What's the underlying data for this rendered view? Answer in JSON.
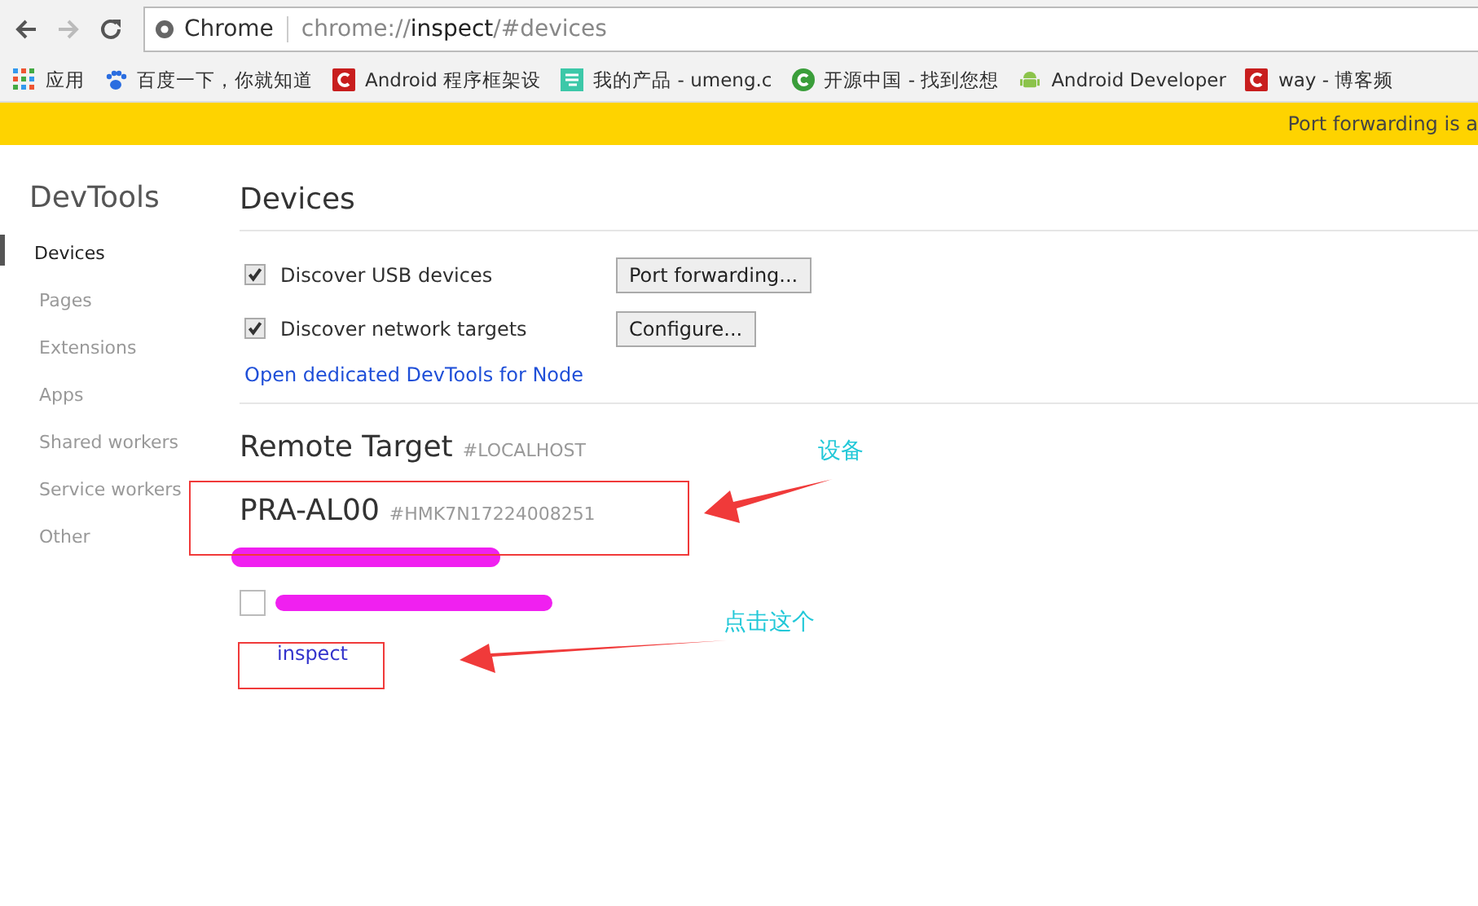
{
  "toolbar": {
    "site_label": "Chrome",
    "url_prefix": "chrome://",
    "url_host": "inspect",
    "url_rest": "/#devices"
  },
  "bookmarks": [
    {
      "label": "应用",
      "kind": "apps"
    },
    {
      "label": "百度一下，你就知道",
      "kind": "paw"
    },
    {
      "label": "Android 程序框架设",
      "kind": "red"
    },
    {
      "label": "我的产品 - umeng.c",
      "kind": "teal"
    },
    {
      "label": "开源中国 - 找到您想",
      "kind": "green-c"
    },
    {
      "label": "Android Developer",
      "kind": "android"
    },
    {
      "label": "way - 博客频",
      "kind": "red"
    }
  ],
  "infobar": {
    "text": "Port forwarding is a"
  },
  "sidebar": {
    "title": "DevTools",
    "items": [
      {
        "label": "Devices",
        "selected": true
      },
      {
        "label": "Pages",
        "selected": false
      },
      {
        "label": "Extensions",
        "selected": false
      },
      {
        "label": "Apps",
        "selected": false
      },
      {
        "label": "Shared workers",
        "selected": false
      },
      {
        "label": "Service workers",
        "selected": false
      },
      {
        "label": "Other",
        "selected": false
      }
    ]
  },
  "devices": {
    "title": "Devices",
    "options": [
      {
        "label": "Discover USB devices",
        "checked": true,
        "button": "Port forwarding..."
      },
      {
        "label": "Discover network targets",
        "checked": true,
        "button": "Configure..."
      }
    ],
    "node_link": "Open dedicated DevTools for Node"
  },
  "remote_target": {
    "title": "Remote Target",
    "tag": "#LOCALHOST",
    "device_name": "PRA-AL00",
    "device_serial": "#HMK7N17224008251",
    "target_checked": false,
    "inspect_link": "inspect"
  },
  "annotations": [
    {
      "label": "设备"
    },
    {
      "label": "点击这个"
    }
  ]
}
